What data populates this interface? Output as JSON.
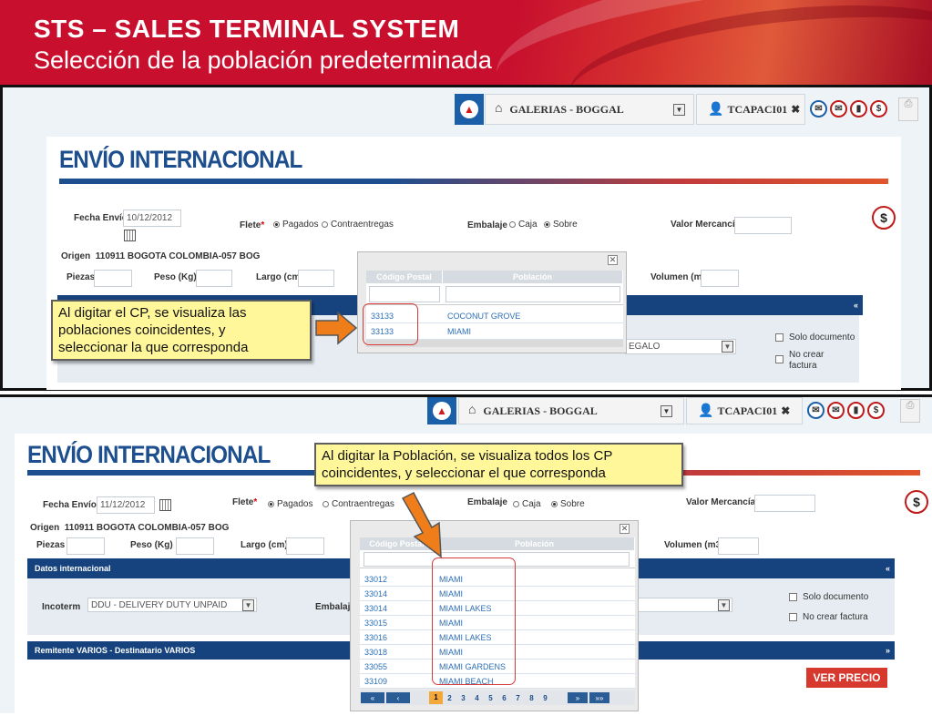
{
  "header": {
    "title": "STS – SALES  TERMINAL SYSTEM",
    "subtitle": "Selección de la población predeterminada"
  },
  "colors": {
    "brand_red": "#c8102e",
    "navy": "#16437e",
    "link_blue": "#2c6fb6",
    "callout": "#fff79a",
    "orange_arrow": "#ef7d1a"
  },
  "toolbar": {
    "office": "GALERIAS - BOGGAL",
    "user": "TCAPACI01",
    "icons": [
      "mail-icon",
      "envelope-icon",
      "bag-icon",
      "dollar-icon"
    ]
  },
  "form": {
    "title": "ENVÍO INTERNACIONAL",
    "fecha_label": "Fecha Envío",
    "flete_label": "Flete",
    "flete_required": "*",
    "pagados": "Pagados",
    "contraentregas": "Contraentregas",
    "embalaje_label": "Embalaje",
    "caja": "Caja",
    "sobre": "Sobre",
    "valor_label": "Valor Mercancía",
    "origen_label": "Origen",
    "origen_value": "110911  BOGOTA  COLOMBIA-057  BOG",
    "piezas_label": "Piezas",
    "peso_label": "Peso (Kg)",
    "largo_label": "Largo (cm)",
    "volumen_label": "Volumen (m3)",
    "solo_documento": "Solo documento",
    "no_crear_factura": "No crear factura",
    "no_crear_l1": "No crear",
    "no_crear_l2": "factura",
    "dollar": "$"
  },
  "panel1": {
    "fecha_value": "10/12/2012",
    "partial_select": "EGALO",
    "popup": {
      "col_cp": "Código Postal",
      "col_pob": "Población",
      "rows": [
        {
          "cp": "33133",
          "pob": "COCONUT GROVE"
        },
        {
          "cp": "33133",
          "pob": "MIAMI"
        }
      ]
    },
    "callout_lines": [
      "Al digitar el CP, se visualiza las",
      "poblaciones coincidentes, y",
      "seleccionar la que corresponda"
    ]
  },
  "panel2": {
    "fecha_value": "11/12/2012",
    "datos_internacional": "Datos internacional",
    "incoterm_label": "Incoterm",
    "incoterm_value": "DDU - DELIVERY DUTY UNPAID",
    "embalaje_label": "Embalaje",
    "remitente_bar": "Remitente VARIOS - Destinatario VARIOS",
    "ver_precio": "VER PRECIO",
    "popup": {
      "col_cp": "Código Postal",
      "col_pob": "Población",
      "rows": [
        {
          "cp": "33012",
          "pob": "MIAMI"
        },
        {
          "cp": "33014",
          "pob": "MIAMI"
        },
        {
          "cp": "33014",
          "pob": "MIAMI LAKES"
        },
        {
          "cp": "33015",
          "pob": "MIAMI"
        },
        {
          "cp": "33016",
          "pob": "MIAMI LAKES"
        },
        {
          "cp": "33018",
          "pob": "MIAMI"
        },
        {
          "cp": "33055",
          "pob": "MIAMI GARDENS"
        },
        {
          "cp": "33109",
          "pob": "MIAMI BEACH"
        }
      ],
      "pager": {
        "first": "«",
        "prev": "‹",
        "pages": [
          "1",
          "2",
          "3",
          "4",
          "5",
          "6",
          "7",
          "8",
          "9"
        ],
        "current": "1",
        "next": "»",
        "last": "»»"
      }
    },
    "callout_lines": [
      "Al digitar la Población, se visualiza todos los CP",
      "coincidentes, y seleccionar el que corresponda"
    ]
  }
}
